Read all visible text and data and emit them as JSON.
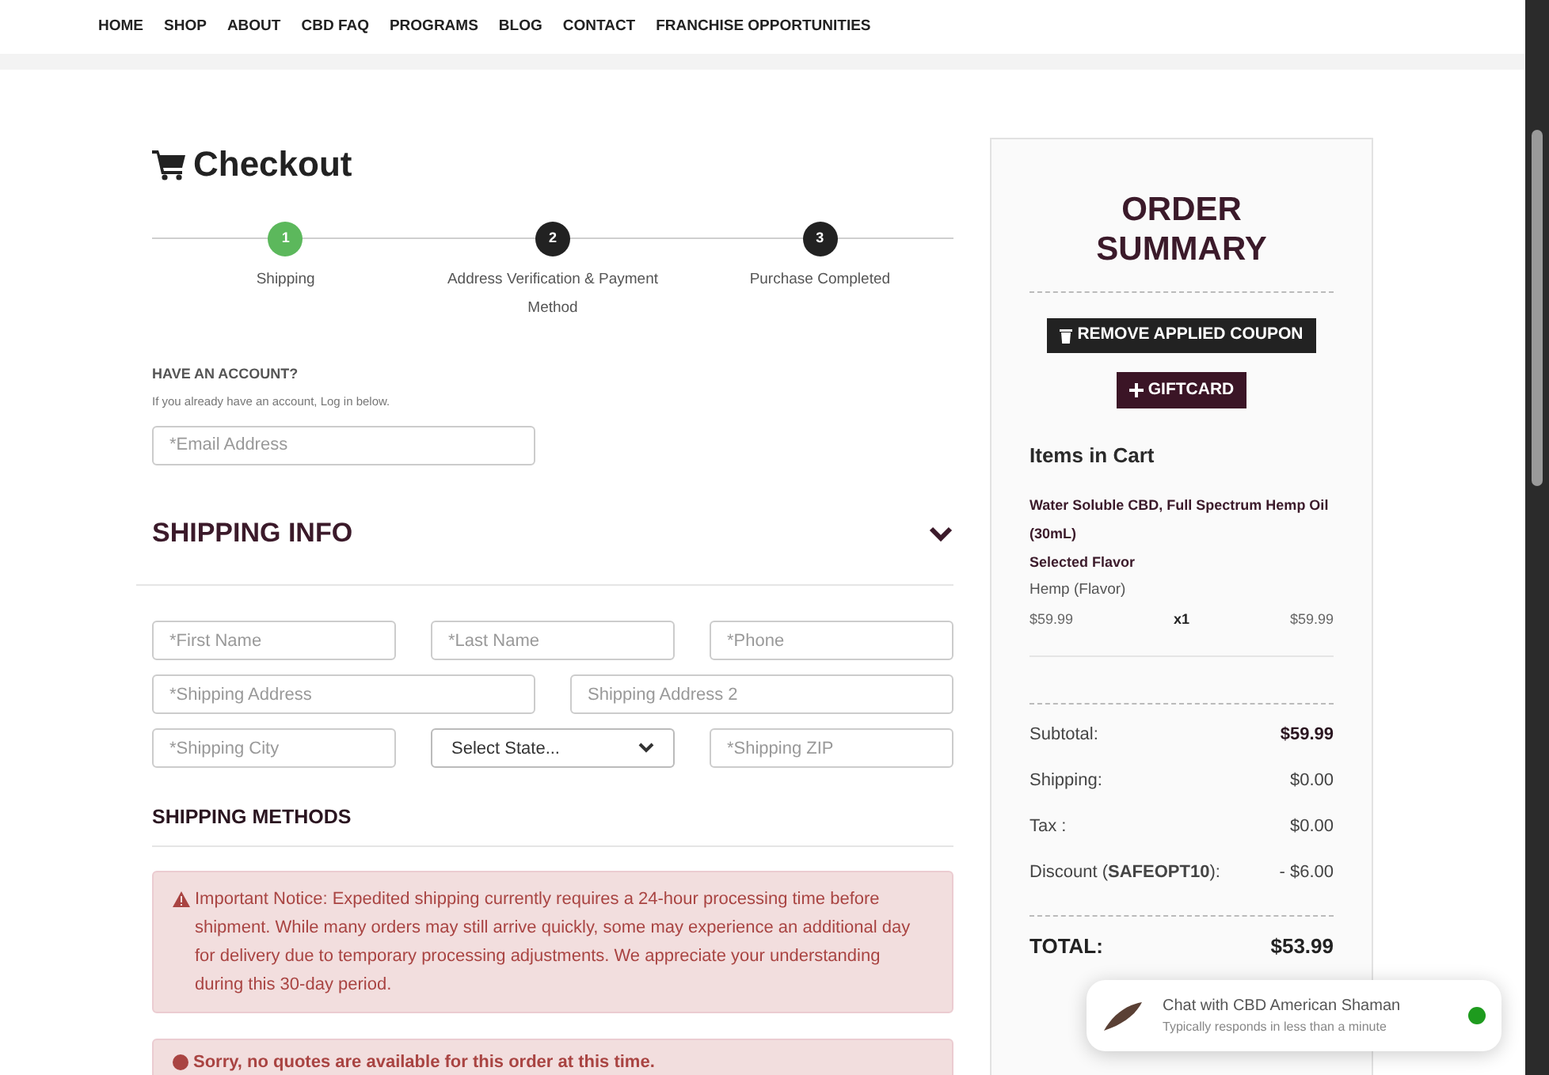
{
  "nav": {
    "items": [
      "HOME",
      "SHOP",
      "ABOUT",
      "CBD FAQ",
      "PROGRAMS",
      "BLOG",
      "CONTACT",
      "FRANCHISE OPPORTUNITIES"
    ]
  },
  "checkout": {
    "title": "Checkout",
    "steps": [
      {
        "number": "1",
        "label": "Shipping",
        "selected": true
      },
      {
        "number": "2",
        "label": "Address Verification & Payment Method",
        "selected": false
      },
      {
        "number": "3",
        "label": "Purchase Completed",
        "selected": false
      }
    ],
    "account": {
      "heading": "HAVE AN ACCOUNT?",
      "hint": "If you already have an account, Log in below.",
      "email": {
        "placeholder": "*Email Address"
      }
    },
    "shipping_info": {
      "heading": "SHIPPING INFO",
      "expanded": true,
      "fields": [
        {
          "kind": "input",
          "placeholder": "*First Name"
        },
        {
          "kind": "input",
          "placeholder": "*Last Name"
        },
        {
          "kind": "input",
          "placeholder": "*Phone"
        },
        {
          "kind": "input",
          "placeholder": "*Shipping Address"
        },
        {
          "kind": "input",
          "placeholder": "Shipping Address 2"
        },
        {
          "kind": "input",
          "placeholder": "*Shipping City"
        },
        {
          "kind": "select",
          "value": "Select State..."
        },
        {
          "kind": "input",
          "placeholder": "*Shipping ZIP"
        }
      ]
    },
    "shipping_methods": {
      "heading": "SHIPPING METHODS",
      "alerts": [
        {
          "kind": "warning",
          "text": "Important Notice: Expedited shipping currently requires a 24-hour processing time before shipment. While many orders may still arrive quickly, some may experience an additional day for delivery due to temporary processing adjustments. We appreciate your understanding during this 30-day period."
        },
        {
          "kind": "error",
          "text": "Sorry, no quotes are available for this order at this time."
        }
      ]
    }
  },
  "order_summary": {
    "title": "ORDER SUMMARY",
    "remove_coupon_button": "REMOVE APPLIED COUPON",
    "giftcard_button": "GIFTCARD",
    "items_heading": "Items in Cart",
    "items": [
      {
        "name": "Water Soluble CBD, Full Spectrum Hemp Oil (30mL)",
        "option_label": "Selected Flavor",
        "option_value": "Hemp (Flavor)",
        "price": "$59.99",
        "quantity": "x1",
        "total": "$59.99"
      }
    ],
    "totals": [
      {
        "label": "Subtotal:",
        "value": "$59.99",
        "bold": true
      },
      {
        "label": "Shipping:",
        "value": "$0.00",
        "bold": false
      },
      {
        "label": "Tax :",
        "value": "$0.00",
        "bold": false
      },
      {
        "label": "Discount (**SAFEOPT10**):",
        "value": "- $6.00",
        "bold": false
      }
    ],
    "grand_total": {
      "label": "TOTAL:",
      "value": "$53.99"
    }
  },
  "chat_widget": {
    "title": "Chat with CBD American Shaman",
    "subtitle": "Typically responds in less than a minute",
    "online": true
  }
}
